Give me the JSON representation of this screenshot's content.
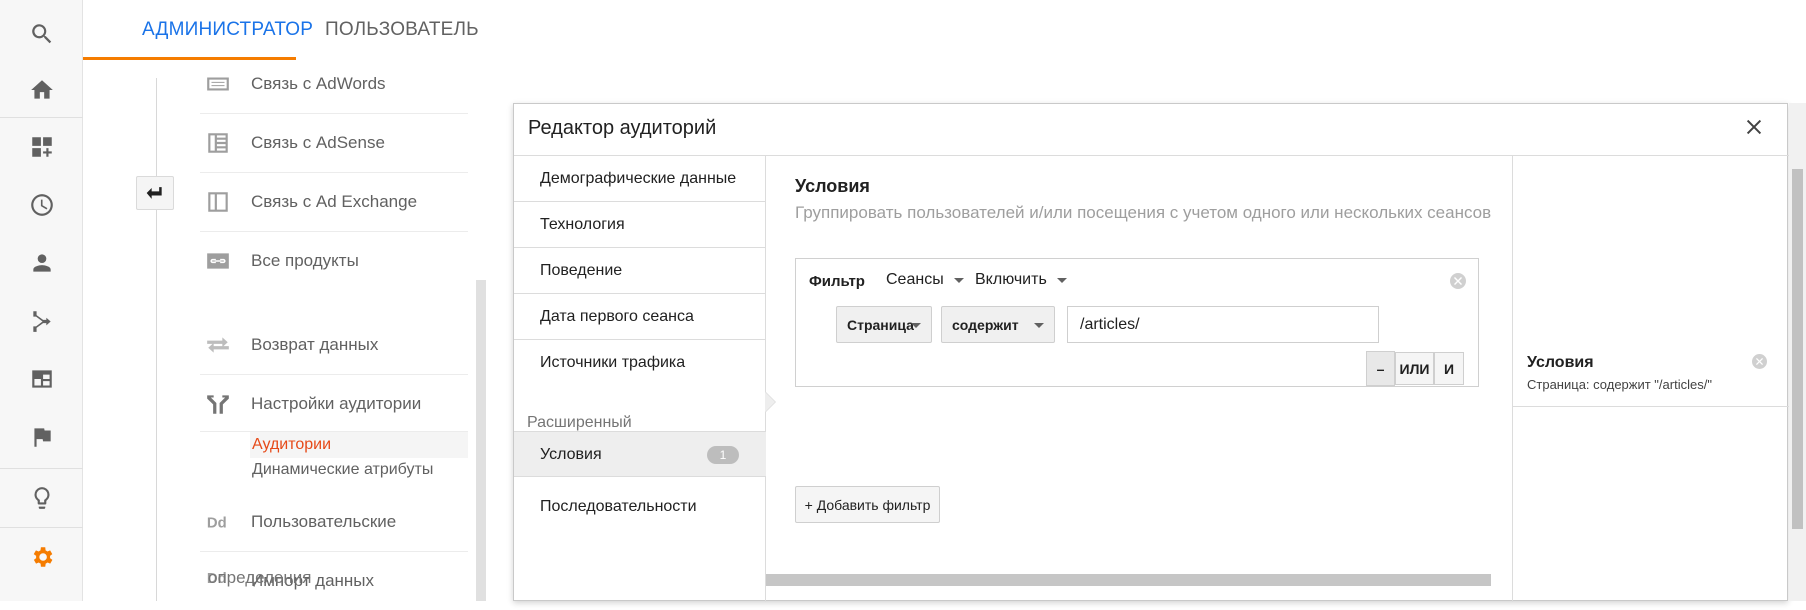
{
  "rail": {
    "icons": [
      "search-icon",
      "home-icon",
      "dashboard-add-icon",
      "clock-icon",
      "person-icon",
      "flow-icon",
      "browser-window-icon",
      "flag-icon",
      "lightbulb-icon",
      "gear-icon"
    ]
  },
  "tabs": {
    "admin": "АДМИНИСТРАТОР",
    "user": "ПОЛЬЗОВАТЕЛЬ"
  },
  "admin_list": {
    "items": [
      {
        "label": "Связь с AdWords",
        "icon": "adwords-icon"
      },
      {
        "label": "Связь с AdSense",
        "icon": "adsense-icon"
      },
      {
        "label": "Связь с Ad Exchange",
        "icon": "ad-exchange-icon"
      },
      {
        "label": "Все продукты",
        "icon": "link-products-icon"
      },
      {
        "label": "Возврат данных",
        "icon": "data-return-icon"
      },
      {
        "label": "Настройки аудитории",
        "icon": "audience-fork-icon"
      },
      {
        "label": "Пользовательские",
        "icon": "dd-icon"
      },
      {
        "label": "Импорт данных",
        "icon": "dd-import-icon"
      }
    ],
    "sub": {
      "audiences": "Аудитории",
      "dynamic_attrs": "Динамические атрибуты"
    },
    "overlap_text": "определения"
  },
  "dialog": {
    "title": "Редактор аудиторий",
    "nav": {
      "items": [
        "Демографические данные",
        "Технология",
        "Поведение",
        "Дата первого сеанса",
        "Источники трафика"
      ],
      "advanced_header": "Расширенный",
      "conditions": "Условия",
      "conditions_count": "1",
      "sequences": "Последовательности"
    },
    "main": {
      "title": "Условия",
      "subtitle": "Группировать пользователей и/или посещения с учетом одного или нескольких сеансов",
      "filter": {
        "label": "Фильтр",
        "scope": "Сеансы",
        "mode": "Включить",
        "dimension": "Страница",
        "operator": "содержит",
        "value": "/articles/",
        "btn_minus": "–",
        "btn_or": "ИЛИ",
        "btn_and": "И"
      },
      "add_filter": "+ Добавить фильтр"
    },
    "summary": {
      "title": "Условия",
      "description": "Страница: содержит \"/articles/\""
    }
  }
}
